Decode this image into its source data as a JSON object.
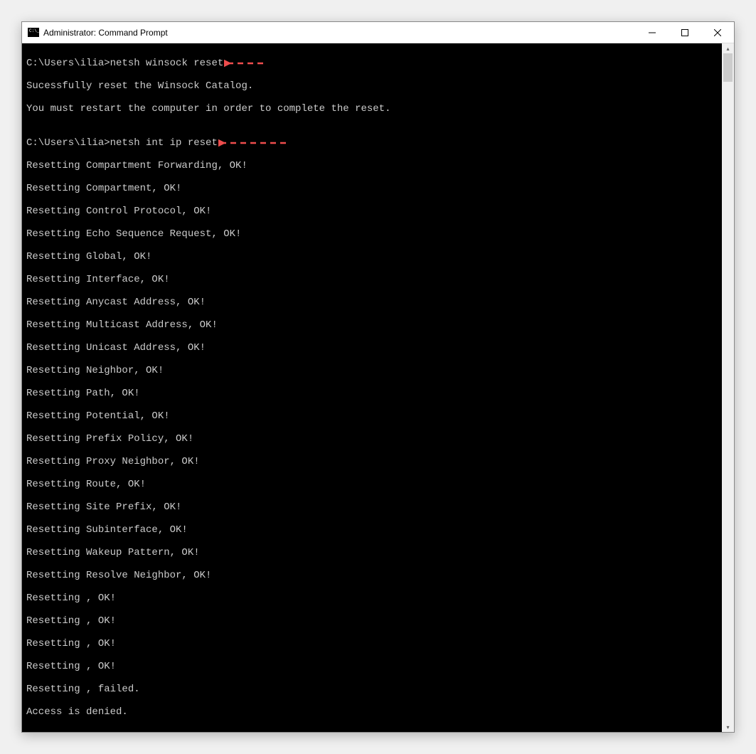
{
  "window": {
    "title": "Administrator: Command Prompt"
  },
  "console": {
    "prompt1": "C:\\Users\\ilia>",
    "command1": "netsh winsock reset",
    "output1_line1": "Sucessfully reset the Winsock Catalog.",
    "output1_line2": "You must restart the computer in order to complete the reset.",
    "prompt2": "C:\\Users\\ilia>",
    "command2": "netsh int ip reset",
    "reset_lines": [
      "Resetting Compartment Forwarding, OK!",
      "Resetting Compartment, OK!",
      "Resetting Control Protocol, OK!",
      "Resetting Echo Sequence Request, OK!",
      "Resetting Global, OK!",
      "Resetting Interface, OK!",
      "Resetting Anycast Address, OK!",
      "Resetting Multicast Address, OK!",
      "Resetting Unicast Address, OK!",
      "Resetting Neighbor, OK!",
      "Resetting Path, OK!",
      "Resetting Potential, OK!",
      "Resetting Prefix Policy, OK!",
      "Resetting Proxy Neighbor, OK!",
      "Resetting Route, OK!",
      "Resetting Site Prefix, OK!",
      "Resetting Subinterface, OK!",
      "Resetting Wakeup Pattern, OK!",
      "Resetting Resolve Neighbor, OK!",
      "Resetting , OK!",
      "Resetting , OK!",
      "Resetting , OK!",
      "Resetting , OK!",
      "Resetting , failed.",
      "Access is denied."
    ]
  },
  "annotations": {
    "arrow_color": "#ed4d4d"
  }
}
